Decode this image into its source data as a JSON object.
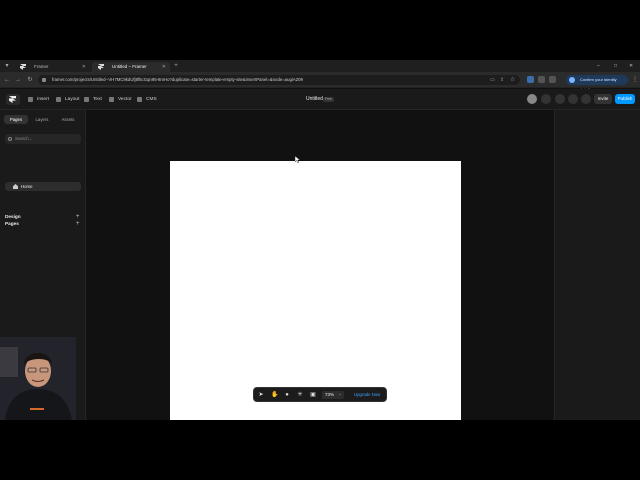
{
  "browser": {
    "tabs": [
      {
        "label": "Framer",
        "active": false
      },
      {
        "label": "Untitled – Framer",
        "active": true
      }
    ],
    "url": "framer.com/projects/Untitled--VH7MC9kdUfj8f5cGqn95-8mHo?duplicate=starter-template-empty-site&insertPanel=&node=augiA209",
    "signin_label": "Confirm your identity details",
    "window_controls": {
      "minimize": "–",
      "maximize": "□",
      "close": "✕"
    }
  },
  "toolbar": {
    "tools": [
      "Insert",
      "Layout",
      "Text",
      "Vector",
      "CMS"
    ],
    "project_title": "Untitled",
    "badge": "Free",
    "invite_label": "Invite",
    "publish_label": "Publish"
  },
  "left_panel": {
    "tabs": [
      "Pages",
      "Layers",
      "Assets"
    ],
    "active_tab": "Pages",
    "search_placeholder": "Search...",
    "design_label": "Design",
    "pages_label": "Pages",
    "pages": [
      "Home"
    ]
  },
  "bottom_bar": {
    "zoom": "73%",
    "zoom_caret": "⌄",
    "upgrade_label": "Upgrade Now"
  },
  "colors": {
    "accent": "#0099ff",
    "canvas_bg": "#111111",
    "frame_bg": "#ffffff"
  }
}
